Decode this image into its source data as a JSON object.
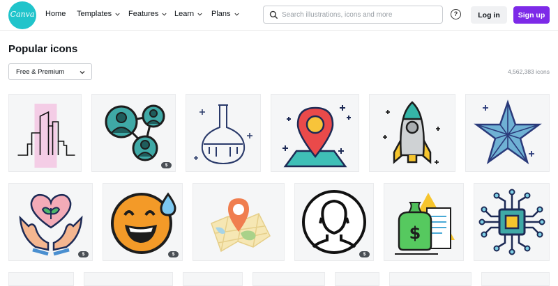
{
  "brand": {
    "logo_text": "Canva",
    "accent_color": "#20c4cb",
    "signup_color": "#7d2ae8"
  },
  "nav": {
    "home": "Home",
    "templates": "Templates",
    "features": "Features",
    "learn": "Learn",
    "plans": "Plans"
  },
  "search": {
    "placeholder": "Search illustrations, icons and more",
    "icon": "search-icon"
  },
  "header": {
    "help_label": "?",
    "login_label": "Log in",
    "signup_label": "Sign up"
  },
  "main": {
    "title": "Popular icons",
    "filter_label": "Free & Premium",
    "result_count": "4,562,383 icons"
  },
  "icons": [
    {
      "name": "city-buildings-icon",
      "premium": false
    },
    {
      "name": "network-people-icon",
      "premium": true,
      "badge": "$"
    },
    {
      "name": "flask-icon",
      "premium": false
    },
    {
      "name": "location-pin-icon",
      "premium": false
    },
    {
      "name": "rocket-icon",
      "premium": false
    },
    {
      "name": "star-icon",
      "premium": false
    },
    {
      "name": "heart-plant-hands-icon",
      "premium": true,
      "badge": "$"
    },
    {
      "name": "sweat-smile-emoji-icon",
      "premium": true,
      "badge": "$"
    },
    {
      "name": "map-pin-icon",
      "premium": false
    },
    {
      "name": "user-avatar-icon",
      "premium": true,
      "badge": "$"
    },
    {
      "name": "money-bag-document-icon",
      "premium": false
    },
    {
      "name": "microchip-icon",
      "premium": false
    }
  ]
}
